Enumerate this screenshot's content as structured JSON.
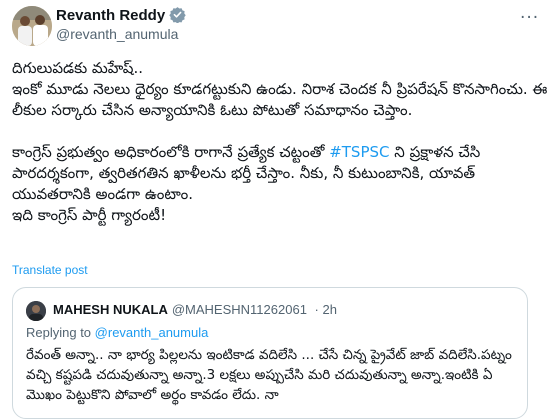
{
  "author": {
    "name": "Revanth Reddy",
    "handle": "@revanth_anumula"
  },
  "icons": {
    "verified": "verified-badge-icon",
    "more": "more-options-icon"
  },
  "colors": {
    "link": "#1d9bf0",
    "secondary": "#536471",
    "verified": "#829aab"
  },
  "post": {
    "text_part1": "దిగులుపడకు మహేష్..\nఇంకో మూడు నెలలు ధైర్యం కూడగట్టుకుని ఉండు. నిరాశ చెందక నీ ప్రిపరేషన్ కొనసాగించు. ఈ లీకుల సర్కారు చేసిన అన్యాయానికి ఓటు పోటుతో సమాధానం చెప్తాం.\n\nకాంగ్రెస్ ప్రభుత్వం అధికారంలోకి రాగానే ప్రత్యేక చట్టంతో ",
    "hashtag": "#TSPSC",
    "text_part2": " ని ప్రక్షాళన చేసి పారదర్శకంగా, త్వరితగతిన ఖాళీలను భర్తీ చేస్తాం. నీకు, నీ కుటుంబానికి, యావత్ యువతరానికి అండగా ఉంటాం.\nఇది కాంగ్రెస్ పార్టీ గ్యారంటీ!",
    "translate": "Translate post"
  },
  "quote": {
    "name": "MAHESH NUKALA",
    "handle": "@MAHESHN11262061",
    "time": "· 2h",
    "replying_prefix": "Replying to",
    "replying_handle": "@revanth_anumula",
    "text": "రేవంత్ అన్నా.. నా భార్య పిల్లలను ఇంటికాడ వదిలేసి ... చేసే చిన్న ప్రైవేట్ జాబ్ వదిలేసి.పట్నం వచ్చి కష్టపడి చదువుతున్నా అన్నా.3 లక్షలు అప్పుచేసి మరి చదువుతున్నా అన్నా.ఇంటికి ఏ మొఖం పెట్టుకొని పోవాలో అర్థం కావడం లేదు. నా"
  }
}
